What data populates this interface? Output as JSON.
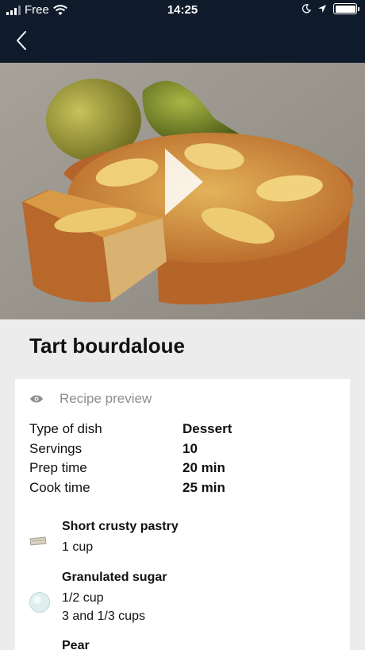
{
  "status_bar": {
    "carrier": "Free",
    "time": "14:25"
  },
  "nav": {
    "back_icon": "chevron-left-icon"
  },
  "colors": {
    "nav_background": "#0f1b2b",
    "page_background": "#ececec",
    "card_background": "#ffffff"
  },
  "recipe": {
    "title": "Tart bourdaloue",
    "preview_label": "Recipe preview",
    "info": [
      {
        "label": "Type of dish",
        "value": "Dessert"
      },
      {
        "label": "Servings",
        "value": "10"
      },
      {
        "label": "Prep time",
        "value": "20 min"
      },
      {
        "label": "Cook time",
        "value": "25 min"
      }
    ],
    "ingredients": [
      {
        "name": "Short crusty pastry",
        "quantities": [
          "1 cup"
        ]
      },
      {
        "name": "Granulated sugar",
        "quantities": [
          "1/2 cup",
          "3 and 1/3 cups"
        ]
      },
      {
        "name": "Pear",
        "quantities": []
      }
    ]
  }
}
